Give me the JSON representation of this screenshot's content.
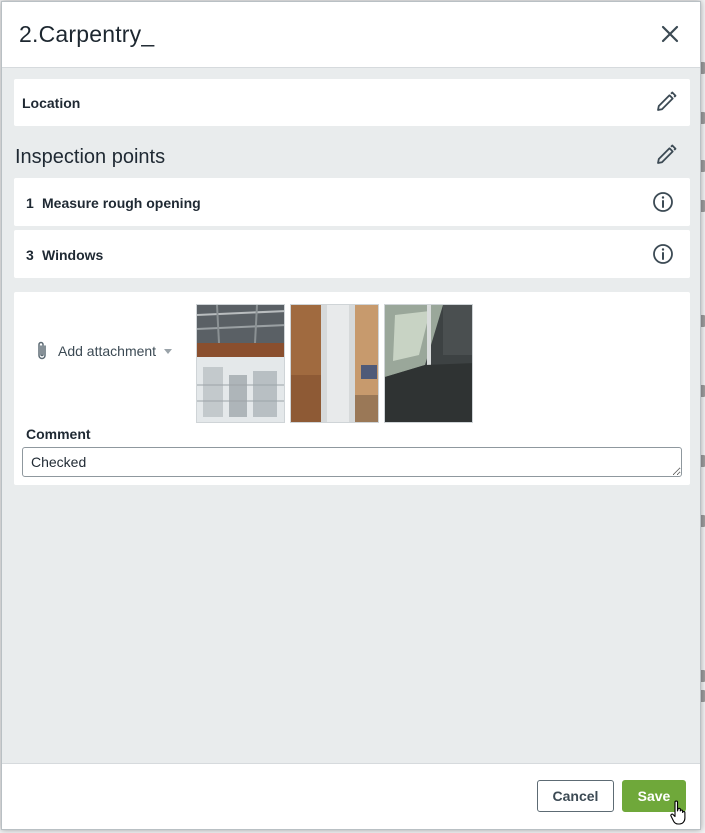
{
  "dialog": {
    "title": "2.Carpentry_"
  },
  "location": {
    "label": "Location"
  },
  "inspection": {
    "title": "Inspection points",
    "items": [
      {
        "number": "1",
        "label": "Measure rough opening"
      },
      {
        "number": "3",
        "label": "Windows"
      }
    ]
  },
  "attachments": {
    "add_label": "Add attachment",
    "photos": [
      "construction-ceiling-photo",
      "window-frame-photo",
      "floor-glass-photo"
    ]
  },
  "comment": {
    "label": "Comment",
    "value": "Checked"
  },
  "footer": {
    "cancel_label": "Cancel",
    "save_label": "Save"
  },
  "colors": {
    "save_button": "#6fa83a",
    "panel_background": "#e9eced",
    "text": "#1f2933"
  },
  "icons": [
    "close-icon",
    "edit-icon",
    "info-icon",
    "paperclip-icon",
    "chevron-down-icon",
    "hand-cursor-icon"
  ]
}
